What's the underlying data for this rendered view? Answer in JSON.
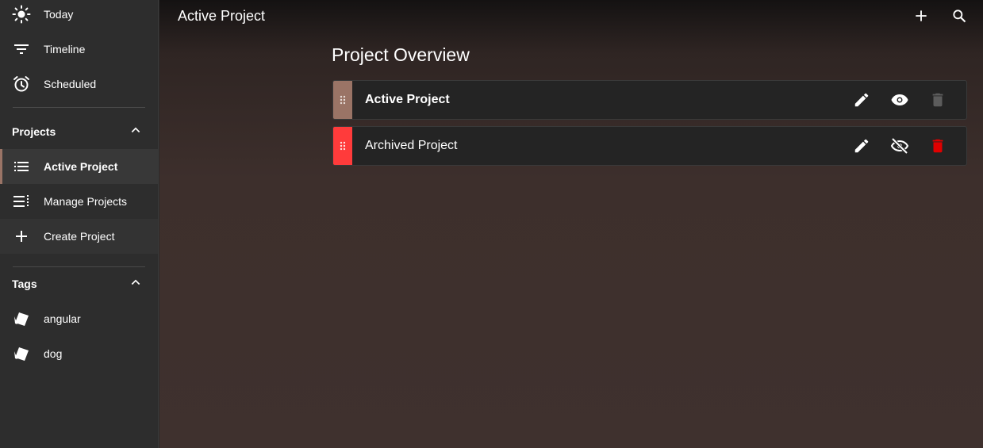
{
  "sidebar": {
    "nav": [
      {
        "label": "Today",
        "icon": "sun-icon"
      },
      {
        "label": "Timeline",
        "icon": "filter-list-icon"
      },
      {
        "label": "Scheduled",
        "icon": "alarm-clock-icon"
      }
    ],
    "projects_section": {
      "title": "Projects",
      "items": [
        {
          "label": "Active Project",
          "icon": "list-icon"
        },
        {
          "label": "Manage Projects",
          "icon": "manage-list-icon"
        },
        {
          "label": "Create Project",
          "icon": "plus-icon"
        }
      ]
    },
    "tags_section": {
      "title": "Tags",
      "items": [
        {
          "label": "angular",
          "icon": "tag-icon"
        },
        {
          "label": "dog",
          "icon": "tag-icon"
        }
      ]
    }
  },
  "header": {
    "title": "Active Project",
    "add_icon": "plus-icon",
    "search_icon": "search-icon"
  },
  "main": {
    "title": "Project Overview",
    "projects": [
      {
        "name": "Active Project",
        "color": "#9a7466",
        "bold": true,
        "visible": true,
        "delete_enabled": false
      },
      {
        "name": "Archived Project",
        "color": "#ff3b3b",
        "bold": false,
        "visible": false,
        "delete_enabled": true
      }
    ]
  },
  "colors": {
    "active_accent": "#9a7466",
    "archived_accent": "#ff3b3b",
    "delete_red": "#e00000"
  }
}
